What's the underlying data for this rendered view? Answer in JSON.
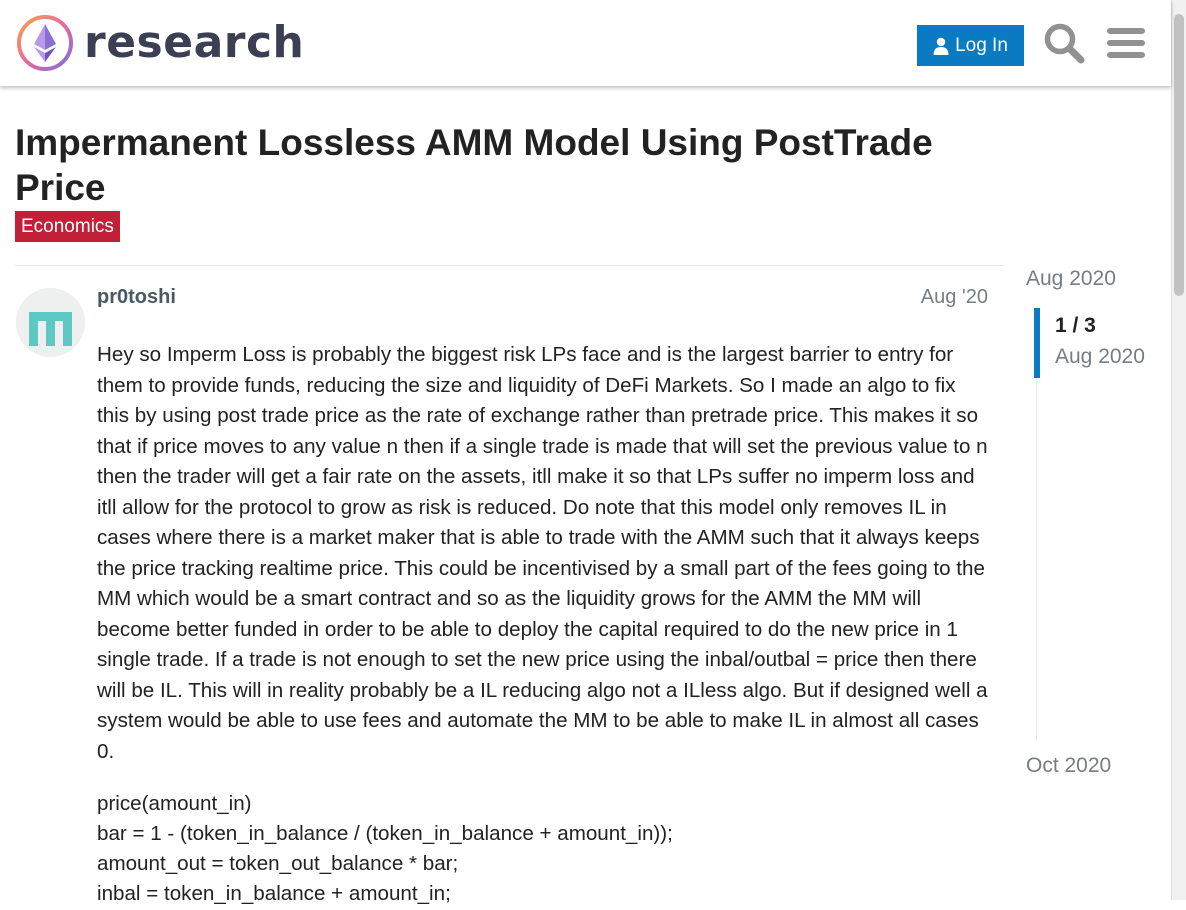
{
  "header": {
    "logo_text": "research",
    "login_label": "Log In",
    "icons": {
      "user": "user-icon",
      "search": "search-icon",
      "menu": "hamburger-menu-icon"
    },
    "accent_color": "#0a7bc2"
  },
  "topic": {
    "title": "Impermanent Lossless AMM Model Using PostTrade Price",
    "category": "Economics",
    "category_color": "#c21f39"
  },
  "post": {
    "author": "pr0toshi",
    "date": "Aug '20",
    "body": "Hey so Imperm Loss is probably the biggest risk LPs face and is the largest barrier to entry for them to provide funds, reducing the size and liquidity of DeFi Markets. So I made an algo to fix this by using post trade price as the rate of exchange rather than pretrade price. This makes it so that if price moves to any value n then if a single trade is made that will set the previous value to n then the trader will get a fair rate on the assets, itll make it so that LPs suffer no imperm loss and itll allow for the protocol to grow as risk is reduced. Do note that this model only removes IL in cases where there is a market maker that is able to trade with the AMM such that it always keeps the price tracking realtime price. This could be incentivised by a small part of the fees going to the MM which would be a smart contract and so as the liquidity grows for the AMM the MM will become better funded in order to be able to deploy the capital required to do the new price in 1 single trade. If a trade is not enough to set the new price using the inbal/outbal = price then there will be IL. This will in reality probably be a IL reducing algo not a ILless algo. But if designed well a system would be able to use fees and automate the MM to be able to make IL in almost all cases 0.",
    "code_lines": [
      "price(amount_in)",
      "bar = 1 - (token_in_balance / (token_in_balance + amount_in));",
      "amount_out = token_out_balance * bar;",
      "inbal = token_in_balance + amount_in;"
    ]
  },
  "timeline": {
    "start_date": "Aug 2020",
    "counter": "1 / 3",
    "current_date": "Aug 2020",
    "end_date": "Oct 2020"
  }
}
